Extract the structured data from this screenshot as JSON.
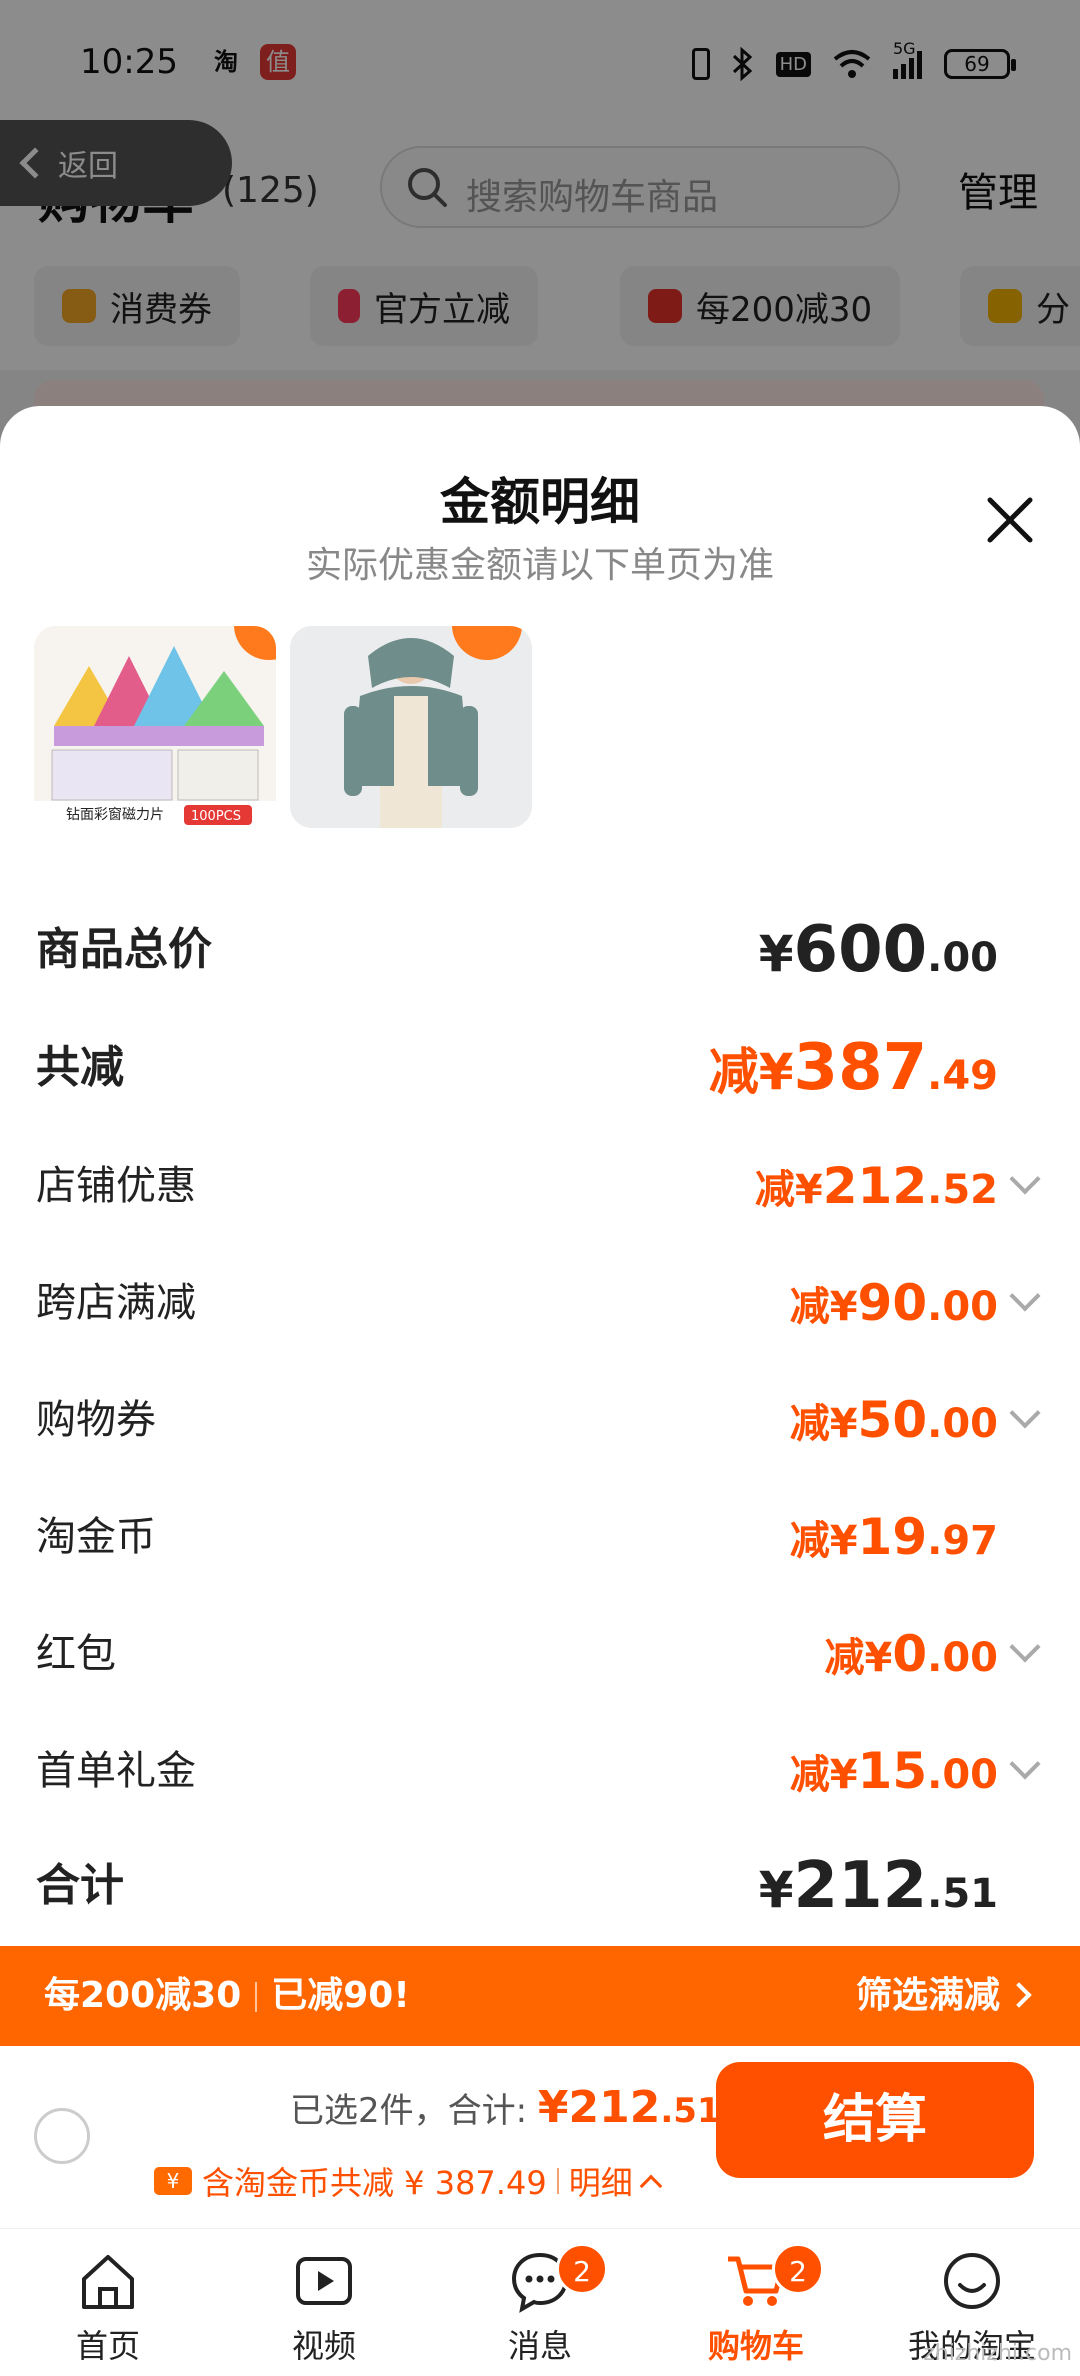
{
  "status_bar": {
    "time": "10:25",
    "left_icon_1": "淘",
    "left_icon_2": "值",
    "network": "5G",
    "hd": "HD",
    "battery": "69"
  },
  "cart_header": {
    "title": "购物车",
    "count": "(125)",
    "search_placeholder": "搜索购物车商品",
    "manage": "管理",
    "back": "返回"
  },
  "filters": [
    {
      "label": "消费券",
      "color": "#f5a623"
    },
    {
      "label": "官方立减",
      "color": "#ff3b5c"
    },
    {
      "label": "每200减30",
      "color": "#e8322b"
    },
    {
      "label": "分",
      "color": "#f5b300"
    }
  ],
  "sheet": {
    "title": "金额明细",
    "subtitle": "实际优惠金额请以下单页为准",
    "thumbnails": [
      {
        "name": "toy",
        "caption": "钻面彩窗磁力片",
        "tag": "100PCS"
      },
      {
        "name": "coat"
      }
    ],
    "rows": [
      {
        "label": "商品总价",
        "prefix": "¥",
        "int": "600",
        "dec": ".00",
        "style": "total",
        "chevron": false
      },
      {
        "label": "共减",
        "prefix": "减¥",
        "int": "387",
        "dec": ".49",
        "style": "discount-total",
        "chevron": false
      },
      {
        "label": "店铺优惠",
        "prefix": "减¥",
        "int": "212",
        "dec": ".52",
        "style": "item",
        "chevron": true
      },
      {
        "label": "跨店满减",
        "prefix": "减¥",
        "int": "90",
        "dec": ".00",
        "style": "item",
        "chevron": true
      },
      {
        "label": "购物券",
        "prefix": "减¥",
        "int": "50",
        "dec": ".00",
        "style": "item",
        "chevron": true
      },
      {
        "label": "淘金币",
        "prefix": "减¥",
        "int": "19",
        "dec": ".97",
        "style": "item",
        "chevron": false
      },
      {
        "label": "红包",
        "prefix": "减¥",
        "int": "0",
        "dec": ".00",
        "style": "item",
        "chevron": true
      },
      {
        "label": "首单礼金",
        "prefix": "减¥",
        "int": "15",
        "dec": ".00",
        "style": "item",
        "chevron": true
      },
      {
        "label": "合计",
        "prefix": "¥",
        "int": "212",
        "dec": ".51",
        "style": "total",
        "chevron": false
      }
    ]
  },
  "promo_bar": {
    "left_1": "每200减30",
    "left_2": "已减90!",
    "right": "筛选满减"
  },
  "settle": {
    "selected": "已选2件，合计: ",
    "total_prefix": "¥",
    "total_int": "212",
    "total_dec": ".51",
    "coupon_icon": "¥",
    "discount_text": "含淘金币共减 ¥ 387.49",
    "detail": "明细",
    "checkout": "结算"
  },
  "nav": [
    {
      "label": "首页",
      "badge": null,
      "active": false
    },
    {
      "label": "视频",
      "badge": null,
      "active": false
    },
    {
      "label": "消息",
      "badge": "2",
      "active": false
    },
    {
      "label": "购物车",
      "badge": "2",
      "active": true
    },
    {
      "label": "我的淘宝",
      "badge": null,
      "active": false
    }
  ],
  "watermark": "zhizhizhi.com",
  "colors": {
    "accent": "#ff5000",
    "promo": "#ff6600"
  }
}
